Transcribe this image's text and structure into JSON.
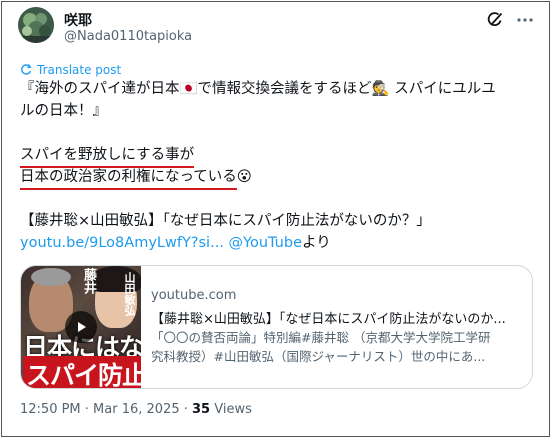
{
  "author": {
    "display_name": "咲耶",
    "handle": "@Nada0110tapioka"
  },
  "translate_label": "Translate post",
  "tweet": {
    "line1": "『海外のスパイ達が日本🇯🇵で情報交換会議をするほど🕵 スパイにユルユ",
    "line2": "ルの日本！』",
    "line3": "スパイを野放しにする事が",
    "line4_prefix": "日本の政治家の利権になっている",
    "line4_emoji": "😮",
    "line5": "【藤井聡×山田敏弘】「なぜ日本にスパイ防止法がないのか？」",
    "link_text": "youtu.be/9Lo8AmyLwfY?si...",
    "mention_text": "@YouTube",
    "suffix": "より"
  },
  "card": {
    "domain": "youtube.com",
    "title": "【藤井聡×山田敏弘】「なぜ日本にスパイ防止法がないのか...",
    "desc_line1": "「〇〇の賛否両論」特別編#藤井聡 （京都大学大学院工学研",
    "desc_line2": "究科教授）#山田敏弘（国際ジャーナリスト）世の中にあ...",
    "thumb_text_1": "日本にはない",
    "thumb_text_2": "スパイ防止",
    "thumb_name_1": "藤井",
    "thumb_name_2": "山田敏弘"
  },
  "meta": {
    "time_date": "12:50 PM · Mar 16, 2025 · ",
    "views_count": "35",
    "views_label": " Views"
  },
  "colors": {
    "link": "#1d9bf0",
    "underline": "#d0191b",
    "secondary_text": "#536471"
  },
  "icons": [
    "grok-icon",
    "more-icon",
    "translate-icon",
    "play-icon"
  ]
}
